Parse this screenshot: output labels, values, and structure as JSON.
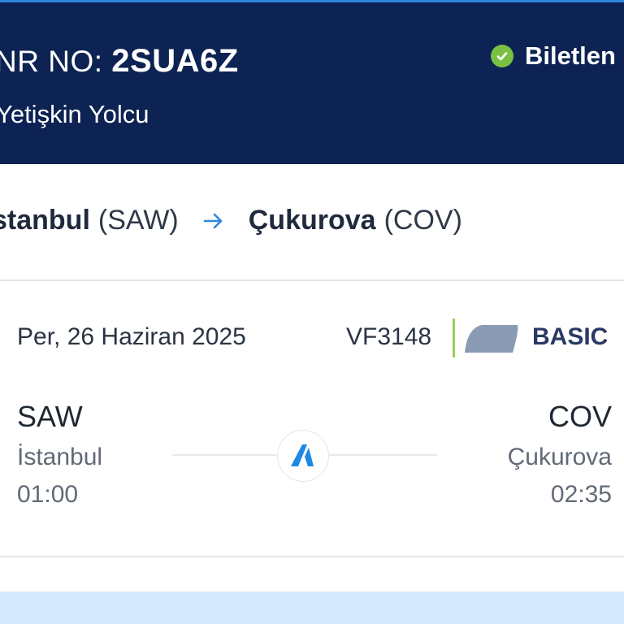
{
  "header": {
    "pnr_label": "NR NO:",
    "pnr_code": "2SUA6Z",
    "passenger": "Yetişkin Yolcu",
    "status": "Biletlen",
    "status_icon": "check-circle-icon",
    "colors": {
      "background": "#0d2353",
      "status_check": "#7ac143"
    }
  },
  "route": {
    "origin_city": "stanbul",
    "origin_code": "(SAW)",
    "destination_city": "Çukurova",
    "destination_code": "(COV)",
    "arrow_icon": "arrow-right-icon"
  },
  "flight": {
    "date": "Per, 26 Haziran 2025",
    "number": "VF3148",
    "fare_icon": "fare-leaf-icon",
    "fare_class": "BASIC",
    "departure": {
      "code": "SAW",
      "city": "İstanbul",
      "time": "01:00"
    },
    "arrival": {
      "code": "COV",
      "city": "Çukurova",
      "time": "02:35"
    },
    "airline_icon": "airline-logo-icon"
  },
  "colors": {
    "accent": "#2e86de",
    "divider_green": "#9acd5a",
    "footer": "#d6e8fb"
  }
}
